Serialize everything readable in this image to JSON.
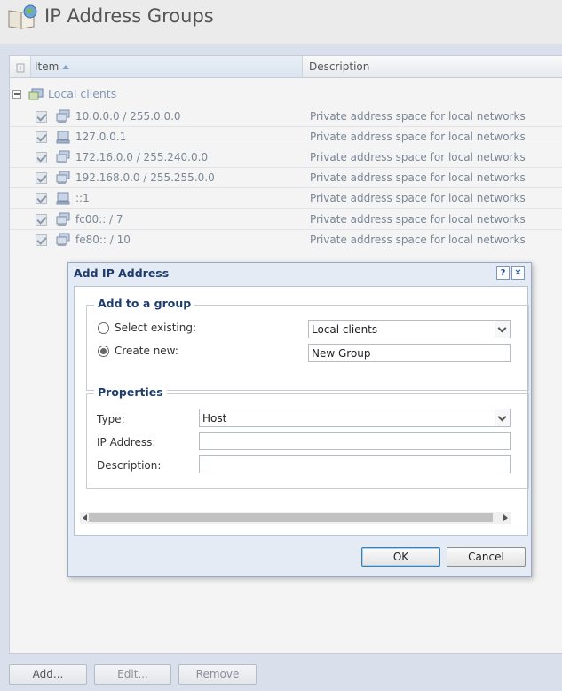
{
  "header": {
    "title": "IP Address Groups",
    "icon": "book-globe-icon"
  },
  "grid": {
    "columns": {
      "item": "Item",
      "description": "Description"
    },
    "group": {
      "label": "Local clients"
    },
    "rows": [
      {
        "item": "10.0.0.0 / 255.0.0.0",
        "description": "Private address space for local networks",
        "icon": "network-icon"
      },
      {
        "item": "127.0.0.1",
        "description": "Private address space for local networks",
        "icon": "host-icon"
      },
      {
        "item": "172.16.0.0 / 255.240.0.0",
        "description": "Private address space for local networks",
        "icon": "network-icon"
      },
      {
        "item": "192.168.0.0 / 255.255.0.0",
        "description": "Private address space for local networks",
        "icon": "network-icon"
      },
      {
        "item": "::1",
        "description": "Private address space for local networks",
        "icon": "host-icon"
      },
      {
        "item": "fc00:: / 7",
        "description": "Private address space for local networks",
        "icon": "network-icon"
      },
      {
        "item": "fe80:: / 10",
        "description": "Private address space for local networks",
        "icon": "network-icon"
      }
    ]
  },
  "dialog": {
    "title": "Add IP Address",
    "help_label": "?",
    "close_label": "✕",
    "group_section": {
      "legend": "Add to a group",
      "select_existing_label": "Select existing:",
      "select_existing_value": "Local clients",
      "create_new_label": "Create new:",
      "create_new_value": "New Group",
      "selected": "create_new"
    },
    "properties": {
      "legend": "Properties",
      "type_label": "Type:",
      "type_value": "Host",
      "ip_label": "IP Address:",
      "ip_value": "",
      "description_label": "Description:",
      "description_value": ""
    },
    "ok_label": "OK",
    "cancel_label": "Cancel"
  },
  "toolbar": {
    "add_label": "Add...",
    "edit_label": "Edit...",
    "remove_label": "Remove"
  },
  "colors": {
    "accent": "#1e3c6e",
    "group_label": "#7e97b6",
    "background": "#d9e0ec"
  }
}
